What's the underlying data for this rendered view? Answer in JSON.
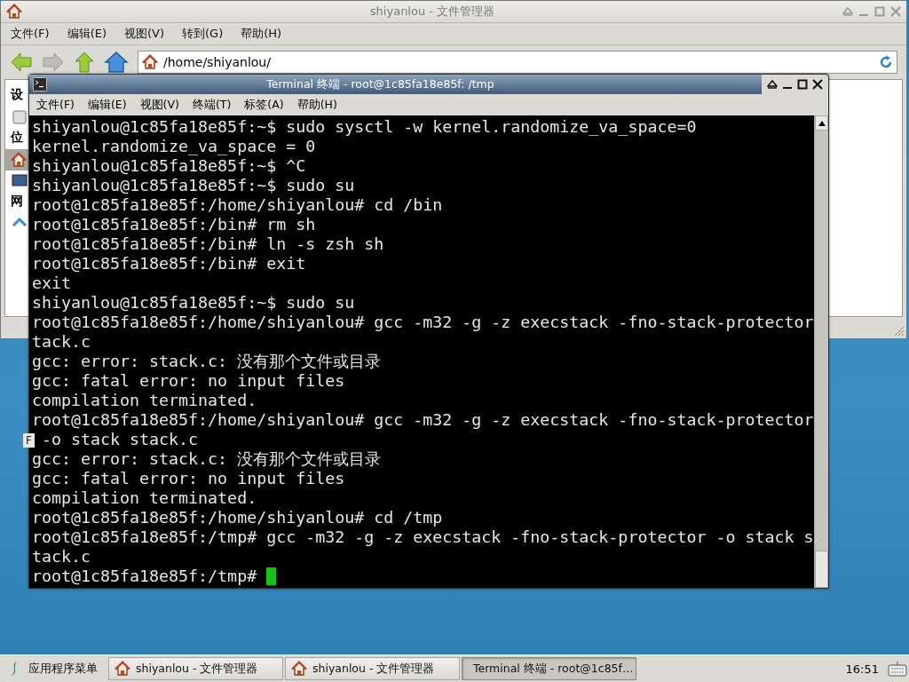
{
  "file_manager": {
    "title": "shiyanlou - 文件管理器",
    "menu": [
      "文件(F)",
      "编辑(E)",
      "视图(V)",
      "转到(G)",
      "帮助(H)"
    ],
    "address": "/home/shiyanlou/",
    "sidebar": [
      {
        "kind": "heading",
        "label": "设"
      },
      {
        "kind": "item",
        "selected": false
      },
      {
        "kind": "heading",
        "label": "位"
      },
      {
        "kind": "item",
        "selected": true
      },
      {
        "kind": "item",
        "selected": false
      },
      {
        "kind": "heading",
        "label": "网"
      },
      {
        "kind": "item",
        "selected": false
      }
    ]
  },
  "desktop_label": "F",
  "terminal": {
    "title": "Terminal 终端 - root@1c85fa18e85f: /tmp",
    "menu": [
      "文件(F)",
      "编辑(E)",
      "视图(V)",
      "终端(T)",
      "标签(A)",
      "帮助(H)"
    ],
    "lines": [
      "shiyanlou@1c85fa18e85f:~$ sudo sysctl -w kernel.randomize_va_space=0",
      "kernel.randomize_va_space = 0",
      "shiyanlou@1c85fa18e85f:~$ ^C",
      "shiyanlou@1c85fa18e85f:~$ sudo su",
      "root@1c85fa18e85f:/home/shiyanlou# cd /bin",
      "root@1c85fa18e85f:/bin# rm sh",
      "root@1c85fa18e85f:/bin# ln -s zsh sh",
      "root@1c85fa18e85f:/bin# exit",
      "exit",
      "shiyanlou@1c85fa18e85f:~$ sudo su",
      "root@1c85fa18e85f:/home/shiyanlou# gcc -m32 -g -z execstack -fno-stack-protector",
      "tack.c",
      "gcc: error: stack.c: 没有那个文件或目录",
      "gcc: fatal error: no input files",
      "compilation terminated.",
      "root@1c85fa18e85f:/home/shiyanlou# gcc -m32 -g -z execstack -fno-stack-protector",
      " -o stack stack.c",
      "gcc: error: stack.c: 没有那个文件或目录",
      "gcc: fatal error: no input files",
      "compilation terminated.",
      "root@1c85fa18e85f:/home/shiyanlou# cd /tmp",
      "root@1c85fa18e85f:/tmp# gcc -m32 -g -z execstack -fno-stack-protector -o stack s",
      "tack.c",
      "root@1c85fa18e85f:/tmp# "
    ]
  },
  "taskbar": {
    "app_menu": "应用程序菜单",
    "tasks": [
      {
        "kind": "folder",
        "label": "shiyanlou - 文件管理器",
        "selected": false
      },
      {
        "kind": "folder",
        "label": "shiyanlou - 文件管理器",
        "selected": false
      },
      {
        "kind": "terminal",
        "label": "Terminal 终端 - root@1c85f…",
        "selected": true
      }
    ],
    "clock": "16:51"
  }
}
